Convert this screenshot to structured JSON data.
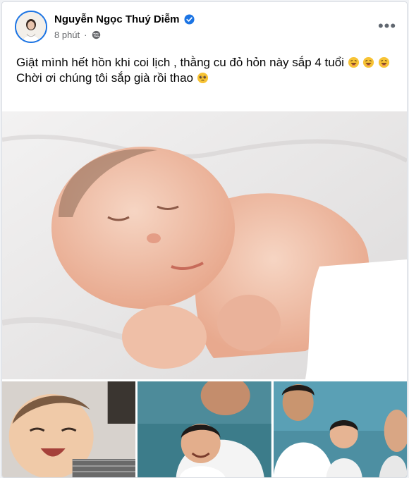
{
  "post": {
    "author": "Nguyễn Ngọc Thuý Diễm",
    "verified": true,
    "time": "8 phút",
    "privacy_icon": "globe-icon",
    "more_icon": "more-icon",
    "text_line1": "Giật mình hết hồn khi coi lịch , thằng cu đỏ hỏn này sắp 4 tuổi",
    "text_line2": "Chời ơi chúng tôi sắp già rồi thao"
  },
  "colors": {
    "accent": "#1b74e4",
    "text": "#050505",
    "secondary": "#65676b"
  }
}
